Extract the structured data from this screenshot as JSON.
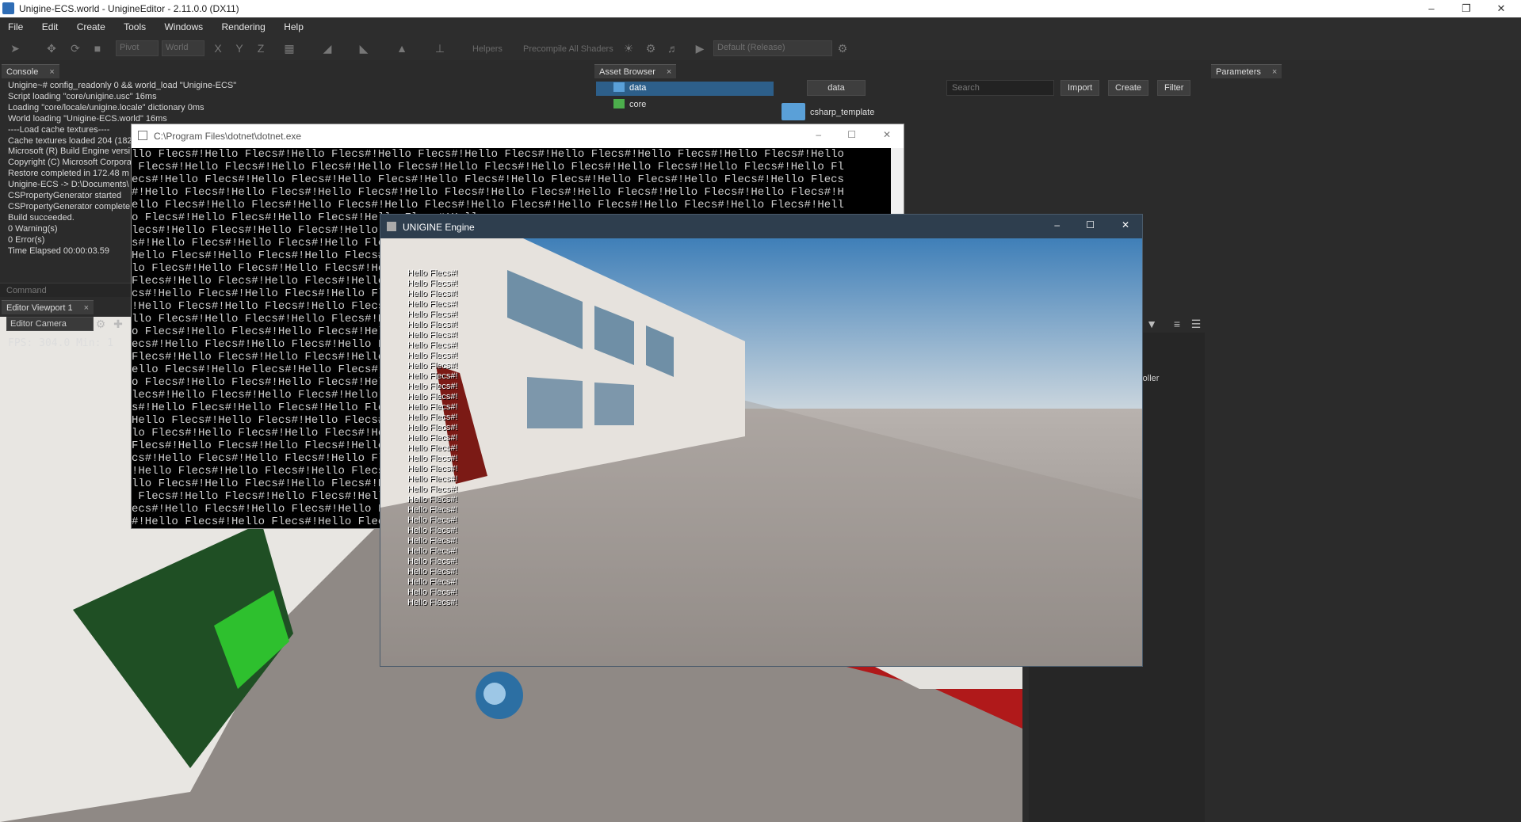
{
  "window": {
    "title": "Unigine-ECS.world - UnigineEditor - 2.11.0.0 (DX11)"
  },
  "menu": [
    "File",
    "Edit",
    "Create",
    "Tools",
    "Windows",
    "Rendering",
    "Help"
  ],
  "toolbar": {
    "pivot": "Pivot",
    "world": "World",
    "helpers": "Helpers",
    "precompile": "Precompile All Shaders",
    "build_config": "Default (Release)"
  },
  "console": {
    "tab": "Console",
    "lines": [
      "Unigine~# config_readonly 0 && world_load \"Unigine-ECS\"",
      "Script loading \"core/unigine.usc\" 16ms",
      "Loading \"core/locale/unigine.locale\" dictionary 0ms",
      "World loading \"Unigine-ECS.world\" 16ms",
      "----Load cache textures----",
      "Cache textures loaded 204 (182",
      "Microsoft (R) Build Engine versi",
      "Copyright (C) Microsoft Corpora",
      "Restore completed in 172.48 m",
      "Unigine-ECS -> D:\\Documents\\",
      "CSPropertyGenerator started",
      "CSPropertyGenerator complete",
      "Build succeeded.",
      "0 Warning(s)",
      "0 Error(s)",
      "Time Elapsed 00:00:03.59"
    ],
    "command_placeholder": "Command"
  },
  "viewport": {
    "tab": "Editor Viewport 1",
    "camera": "Editor Camera",
    "fps": "FPS: 304.0    Min: 1"
  },
  "dotnet": {
    "title": "C:\\Program Files\\dotnet\\dotnet.exe",
    "lines": [
      "llo Flecs#!Hello Flecs#!Hello Flecs#!Hello Flecs#!Hello Flecs#!Hello Flecs#!Hello Flecs#!Hello Flecs#!Hello",
      " Flecs#!Hello Flecs#!Hello Flecs#!Hello Flecs#!Hello Flecs#!Hello Flecs#!Hello Flecs#!Hello Flecs#!Hello Fl",
      "ecs#!Hello Flecs#!Hello Flecs#!Hello Flecs#!Hello Flecs#!Hello Flecs#!Hello Flecs#!Hello Flecs#!Hello Flecs",
      "#!Hello Flecs#!Hello Flecs#!Hello Flecs#!Hello Flecs#!Hello Flecs#!Hello Flecs#!Hello Flecs#!Hello Flecs#!H",
      "ello Flecs#!Hello Flecs#!Hello Flecs#!Hello Flecs#!Hello Flecs#!Hello Flecs#!Hello Flecs#!Hello Flecs#!Hell",
      "o Flecs#!Hello Flecs#!Hello Flecs#!Hello Flecs#!Hello",
      "lecs#!Hello Flecs#!Hello Flecs#!Hello Flecs#!Hello F",
      "s#!Hello Flecs#!Hello Flecs#!Hello Flecs#!Hello Fl",
      "Hello Flecs#!Hello Flecs#!Hello Flecs#!Hello Flecs#",
      "lo Flecs#!Hello Flecs#!Hello Flecs#!Hello Flecs#!Hel",
      "Flecs#!Hello Flecs#!Hello Flecs#!Hello Flecs#!Hello F",
      "cs#!Hello Flecs#!Hello Flecs#!Hello Flecs#!Hello Fle",
      "!Hello Flecs#!Hello Flecs#!Hello Flecs#!Hello Flecs",
      "llo Flecs#!Hello Flecs#!Hello Flecs#!Hello Flecs#!He",
      "o Flecs#!Hello Flecs#!Hello Flecs#!Hello Flecs#!Hello",
      "ecs#!Hello Flecs#!Hello Flecs#!Hello Flecs#!Hello Fle",
      "Flecs#!Hello Flecs#!Hello Flecs#!Hello Flecs#!Hello F",
      "ello Flecs#!Hello Flecs#!Hello Flecs#!Hello Flecs#!H",
      "o Flecs#!Hello Flecs#!Hello Flecs#!Hello Flecs#!Hello",
      "lecs#!Hello Flecs#!Hello Flecs#!Hello Flecs#!Hello F",
      "s#!Hello Flecs#!Hello Flecs#!Hello Flecs#!Hello Flec",
      "Hello Flecs#!Hello Flecs#!Hello Flecs#!Hello Flecs#!",
      "lo Flecs#!Hello Flecs#!Hello Flecs#!Hello Flecs#!Hel",
      "Flecs#!Hello Flecs#!Hello Flecs#!Hello Flecs#!Hello F",
      "cs#!Hello Flecs#!Hello Flecs#!Hello Flecs#!Hello Fle",
      "!Hello Flecs#!Hello Flecs#!Hello Flecs#!Hello Flecs",
      "llo Flecs#!Hello Flecs#!Hello Flecs#!Hello Flecs#!He",
      " Flecs#!Hello Flecs#!Hello Flecs#!Hello Flecs#!Hello",
      "ecs#!Hello Flecs#!Hello Flecs#!Hello Flecs#!Hello Fle",
      "#!Hello Flecs#!Hello Flecs#!Hello Flecs#!Hello Flecs"
    ]
  },
  "engine": {
    "title": "UNIGINE Engine",
    "overlay_text": "Hello Flecs#!",
    "overlay_count": 33
  },
  "assets": {
    "tab": "Asset Browser",
    "tree": [
      "data",
      "core"
    ],
    "path": "data",
    "search_placeholder": "Search",
    "import": "Import",
    "create": "Create",
    "filter": "Filter",
    "folder": "csharp_template"
  },
  "params": {
    "tab": "Parameters",
    "fragment": "roller"
  }
}
